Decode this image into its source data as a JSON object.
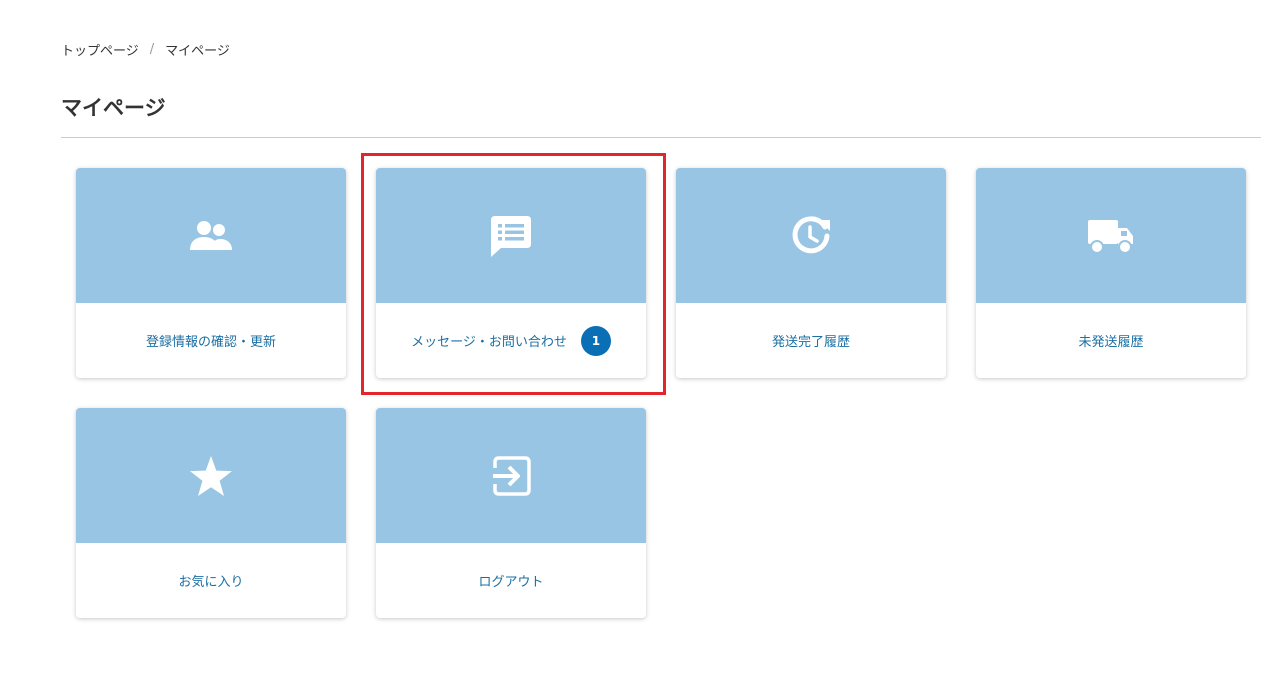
{
  "breadcrumb": {
    "home": "トップページ",
    "separator": "/",
    "current": "マイページ"
  },
  "page": {
    "title": "マイページ"
  },
  "colors": {
    "card_header": "#97c5e3",
    "link_text": "#1a6fa3",
    "badge": "#0a6fb5",
    "highlight": "#e3262c"
  },
  "cards": [
    {
      "label": "登録情報の確認・更新",
      "icon": "users-icon"
    },
    {
      "label": "メッセージ・お問い合わせ",
      "icon": "message-list-icon",
      "badge": "1"
    },
    {
      "label": "発送完了履歴",
      "icon": "history-clock-icon"
    },
    {
      "label": "未発送履歴",
      "icon": "truck-icon"
    },
    {
      "label": "お気に入り",
      "icon": "star-icon"
    },
    {
      "label": "ログアウト",
      "icon": "logout-icon"
    }
  ]
}
